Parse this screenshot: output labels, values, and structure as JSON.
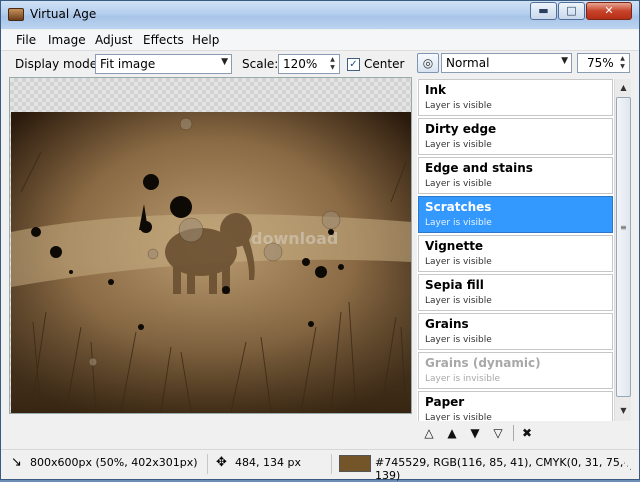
{
  "window": {
    "title": "Virtual Age"
  },
  "menu": [
    "File",
    "Image",
    "Adjust",
    "Effects",
    "Help"
  ],
  "toolbar": {
    "display_mode_label": "Display mode:",
    "display_mode_value": "Fit image",
    "scale_label": "Scale:",
    "scale_value": "120%",
    "center_label": "Center",
    "center_checked": true
  },
  "layers_panel": {
    "blend_mode": "Normal",
    "opacity": "75%",
    "layers": [
      {
        "name": "Ink",
        "status": "Layer is visible",
        "selected": false,
        "visible": true
      },
      {
        "name": "Dirty edge",
        "status": "Layer is visible",
        "selected": false,
        "visible": true
      },
      {
        "name": "Edge and stains",
        "status": "Layer is visible",
        "selected": false,
        "visible": true
      },
      {
        "name": "Scratches",
        "status": "Layer is visible",
        "selected": true,
        "visible": true
      },
      {
        "name": "Vignette",
        "status": "Layer is visible",
        "selected": false,
        "visible": true
      },
      {
        "name": "Sepia fill",
        "status": "Layer is visible",
        "selected": false,
        "visible": true
      },
      {
        "name": "Grains",
        "status": "Layer is visible",
        "selected": false,
        "visible": true
      },
      {
        "name": "Grains (dynamic)",
        "status": "Layer is invisible",
        "selected": false,
        "visible": false
      },
      {
        "name": "Paper",
        "status": "Layer is visible",
        "selected": false,
        "visible": true
      }
    ],
    "actions": [
      "move-top",
      "move-up",
      "move-down",
      "move-bottom",
      "delete"
    ]
  },
  "photo": {
    "watermark": "download"
  },
  "status": {
    "image_size": "800x600px (50%, 402x301px)",
    "cursor": "484, 134 px",
    "color_text": "#745529, RGB(116, 85, 41), CMYK(0, 31, 75, 139)",
    "color_hex": "#745529"
  },
  "colors": {
    "selection": "#3399ff",
    "sepia": "#745529"
  }
}
